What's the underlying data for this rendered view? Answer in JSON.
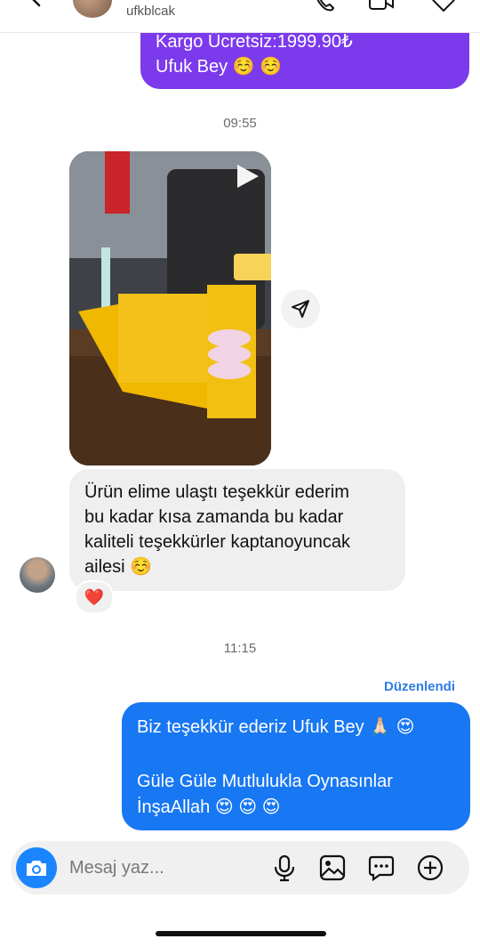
{
  "header": {
    "username": "ufkblcak"
  },
  "messages": {
    "outgoing_top": {
      "line1": "Kargo Ücretsiz:1999.90₺",
      "line2": "Ufuk Bey ☺️ ☺️"
    },
    "time1": "09:55",
    "incoming_text": {
      "line1": "Ürün elime ulaştı teşekkür ederim",
      "line2": "bu kadar kısa zamanda bu kadar",
      "line3": "kaliteli teşekkürler kaptanoyuncak",
      "line4": "ailesi ☺️"
    },
    "reaction": "❤️",
    "time2": "11:15",
    "edited_label": "Düzenlendi",
    "outgoing_reply": {
      "line1": "Biz teşekkür ederiz Ufuk Bey 🙏🏻 😍",
      "line2": "Güle Güle Mutlulukla Oynasınlar",
      "line3": "İnşaAllah 😍 😍 😍"
    }
  },
  "composer": {
    "placeholder": "Mesaj yaz..."
  },
  "colors": {
    "outgoing_purple": "#7c3aed",
    "outgoing_blue": "#1877f2",
    "incoming_gray": "#efefef",
    "accent": "#2f7de1"
  },
  "icons": [
    "back-icon",
    "phone-icon",
    "video-icon",
    "heart-icon",
    "play-icon",
    "share-icon",
    "camera-icon",
    "microphone-icon",
    "gallery-icon",
    "sticker-icon",
    "plus-icon"
  ]
}
